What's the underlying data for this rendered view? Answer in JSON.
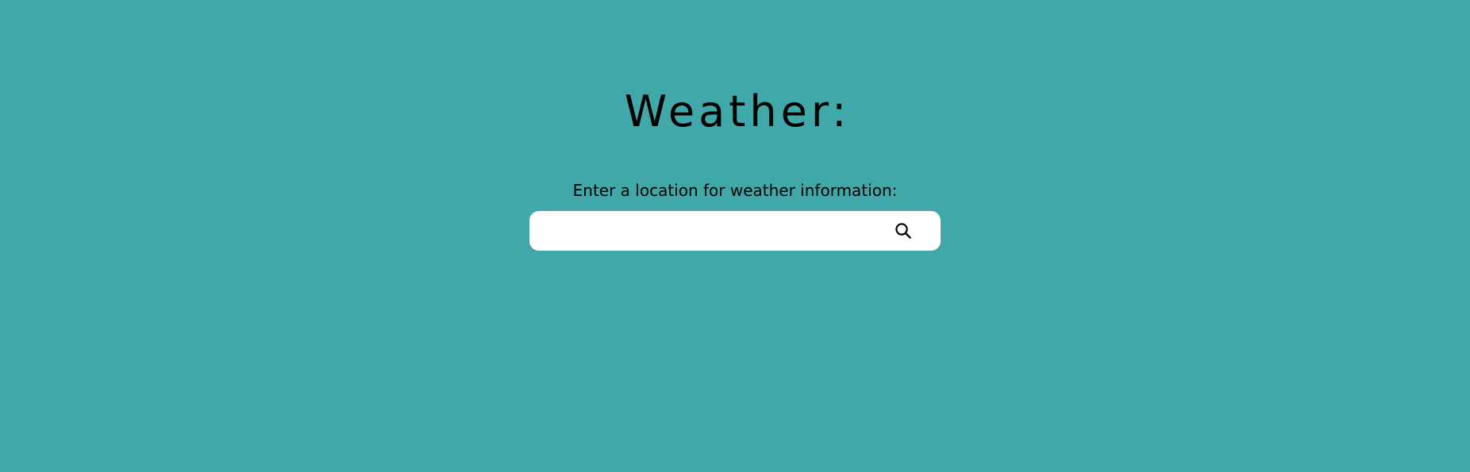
{
  "header": {
    "title": "Weather:"
  },
  "search": {
    "prompt": "Enter a location for weather information:",
    "value": "",
    "placeholder": "",
    "button_icon": "search-icon"
  },
  "colors": {
    "background": "#41a8aa",
    "search_bar": "#ffffff",
    "text": "#000000"
  }
}
